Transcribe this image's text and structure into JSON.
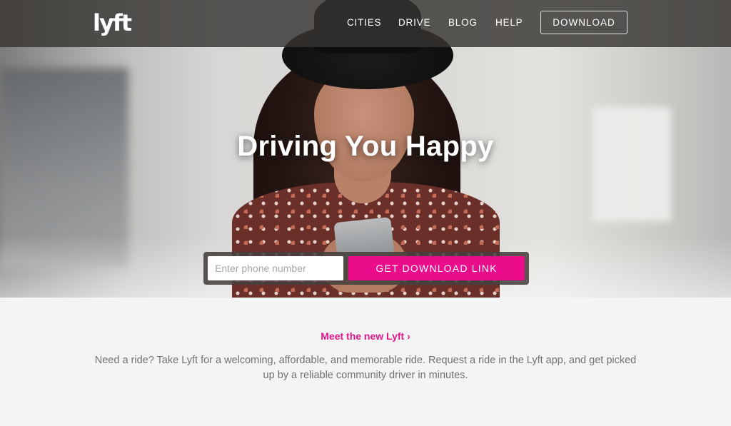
{
  "brand": {
    "logo_text": "lyft",
    "accent_color": "#eb0c8c"
  },
  "nav": {
    "items": [
      {
        "label": "CITIES"
      },
      {
        "label": "DRIVE"
      },
      {
        "label": "BLOG"
      },
      {
        "label": "HELP"
      }
    ],
    "download_label": "DOWNLOAD"
  },
  "hero": {
    "headline": "Driving You Happy",
    "phone_placeholder": "Enter phone number",
    "phone_value": "",
    "cta_label": "GET DOWNLOAD LINK"
  },
  "intro": {
    "link_text": "Meet the new Lyft ›",
    "description": "Need a ride? Take Lyft for a welcoming, affordable, and memorable ride. Request a ride in the Lyft app, and get picked up by a reliable community driver in minutes."
  }
}
